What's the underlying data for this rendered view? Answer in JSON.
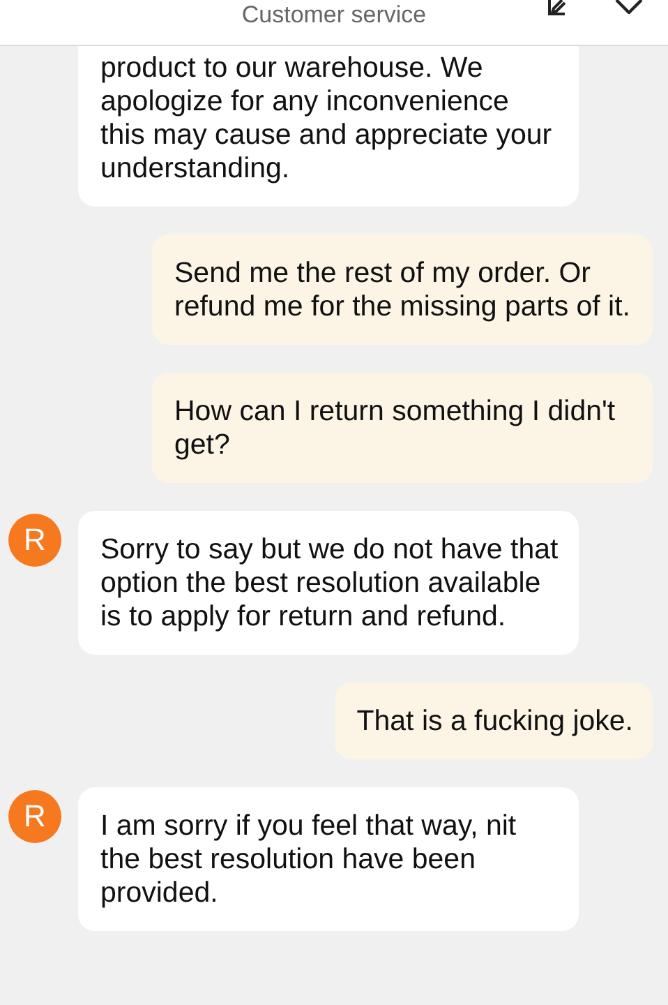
{
  "header": {
    "title": "Customer service"
  },
  "messages": [
    {
      "kind": "received",
      "text": "product to our warehouse. We apologize for any inconvenience this may cause and appreciate your understanding."
    },
    {
      "kind": "sent",
      "text": "Send me the rest of my order. Or refund me for the missing parts of it."
    },
    {
      "kind": "sent",
      "text": "How can I return something I didn't get?"
    },
    {
      "kind": "received",
      "avatar": "R",
      "text": "Sorry to say but we do not have that option the best resolution available is to apply for return and refund."
    },
    {
      "kind": "sent",
      "text": "That is a fucking joke."
    },
    {
      "kind": "received",
      "avatar": "R",
      "text": "I am sorry if you feel that way, nit the best resolution have been provided."
    }
  ]
}
